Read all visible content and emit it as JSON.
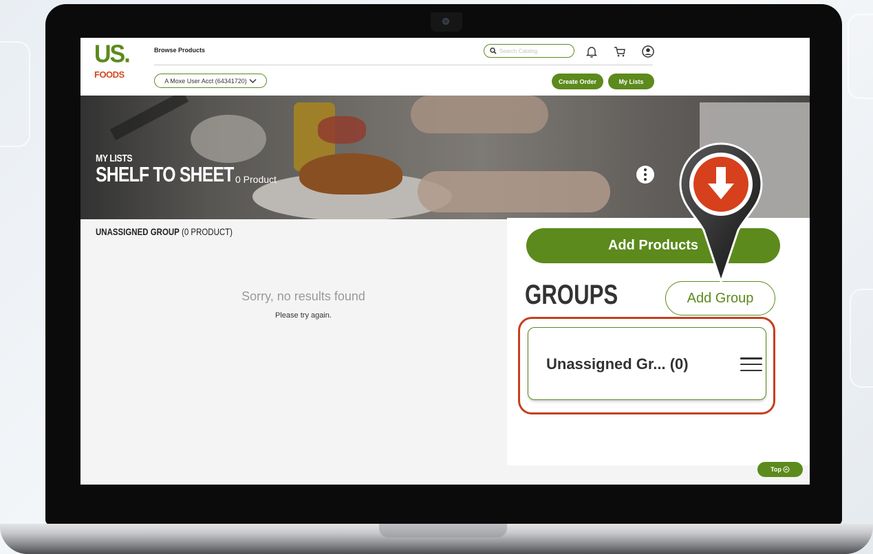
{
  "brand": {
    "logo_us": "US.",
    "logo_foods": "FOODS",
    "primary": "#5c8a1c",
    "accent": "#c4401c"
  },
  "header": {
    "browse_products": "Browse Products",
    "search_placeholder": "Search Catalog",
    "account_selector": "A Moxe User Acct (64341720)",
    "create_order": "Create Order",
    "my_lists": "My Lists",
    "icons": [
      "search-icon",
      "bell-icon",
      "cart-icon",
      "user-icon"
    ]
  },
  "hero": {
    "section": "MY LISTS",
    "title": "SHELF TO SHEET",
    "product_count": "0 Product"
  },
  "left": {
    "group_name": "UNASSIGNED GROUP",
    "group_count": "(0 PRODUCT)",
    "no_results": "Sorry, no results found",
    "try_again": "Please try again."
  },
  "right": {
    "add_products": "Add Products",
    "groups_heading": "GROUPS",
    "add_group": "Add Group",
    "group_card_label": "Unassigned Gr... (0)"
  },
  "footer": {
    "top_button": "Top"
  }
}
